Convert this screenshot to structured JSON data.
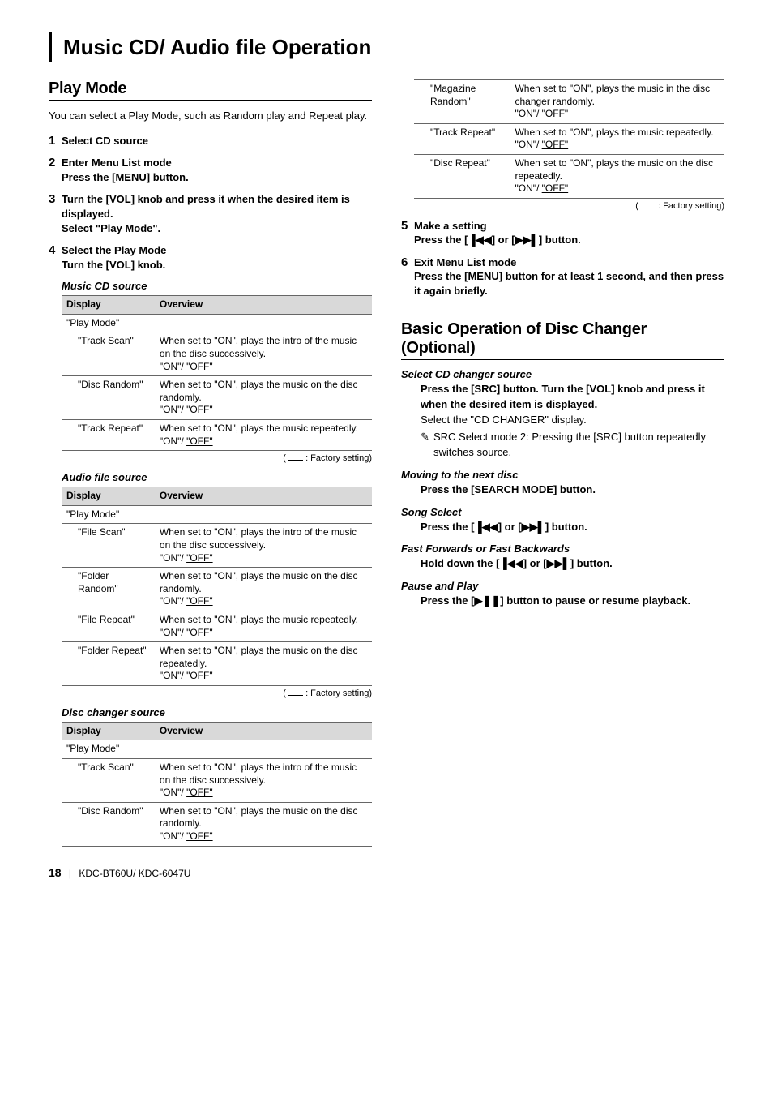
{
  "page_title": "Music CD/ Audio file Operation",
  "left": {
    "play_mode_heading": "Play Mode",
    "play_mode_intro": "You can select a Play Mode, such as Random play and Repeat play.",
    "steps": [
      {
        "num": "1",
        "title": "Select CD source",
        "subs": []
      },
      {
        "num": "2",
        "title": "Enter Menu List mode",
        "subs": [
          "Press the [MENU] button."
        ]
      },
      {
        "num": "3",
        "title": "Turn the [VOL] knob and press it when the desired item is displayed.",
        "subs": [
          "Select \"Play Mode\"."
        ]
      },
      {
        "num": "4",
        "title": "Select the Play Mode",
        "subs": [
          "Turn the [VOL] knob."
        ]
      }
    ],
    "music_cd_label": "Music CD source",
    "audio_file_label": "Audio file source",
    "disc_changer_label": "Disc changer source",
    "col_display": "Display",
    "col_overview": "Overview",
    "play_mode_row": "\"Play Mode\"",
    "factory_label": " : Factory setting)",
    "music_cd_rows": [
      {
        "d": "\"Track Scan\"",
        "o": "When set to \"ON\", plays the intro of the music on the disc successively.",
        "s": "\"ON\"/ \"OFF\""
      },
      {
        "d": "\"Disc Random\"",
        "o": "When set to \"ON\", plays the music on the disc randomly.",
        "s": "\"ON\"/ \"OFF\""
      },
      {
        "d": "\"Track Repeat\"",
        "o": "When set to \"ON\", plays the music repeatedly.",
        "s": "\"ON\"/ \"OFF\""
      }
    ],
    "audio_file_rows": [
      {
        "d": "\"File Scan\"",
        "o": "When set to \"ON\", plays the intro of the music on the disc successively.",
        "s": "\"ON\"/ \"OFF\""
      },
      {
        "d": "\"Folder Random\"",
        "o": "When set to \"ON\", plays the music on the disc randomly.",
        "s": "\"ON\"/ \"OFF\""
      },
      {
        "d": "\"File Repeat\"",
        "o": "When set to \"ON\", plays the music repeatedly.",
        "s": "\"ON\"/ \"OFF\""
      },
      {
        "d": "\"Folder Repeat\"",
        "o": "When set to \"ON\", plays the music on the disc repeatedly.",
        "s": "\"ON\"/ \"OFF\""
      }
    ],
    "disc_changer_rows": [
      {
        "d": "\"Track Scan\"",
        "o": "When set to \"ON\", plays the intro of the music on the disc successively.",
        "s": "\"ON\"/ \"OFF\""
      },
      {
        "d": "\"Disc Random\"",
        "o": "When set to \"ON\", plays the music on the disc randomly.",
        "s": "\"ON\"/ \"OFF\""
      }
    ]
  },
  "right": {
    "top_rows": [
      {
        "d": "\"Magazine Random\"",
        "o": "When set to \"ON\", plays the music in the disc changer randomly.",
        "s": "\"ON\"/ \"OFF\""
      },
      {
        "d": "\"Track Repeat\"",
        "o": "When set to \"ON\", plays the music repeatedly.",
        "s": "\"ON\"/ \"OFF\""
      },
      {
        "d": "\"Disc Repeat\"",
        "o": "When set to \"ON\", plays the music on the disc repeatedly.",
        "s": "\"ON\"/ \"OFF\""
      }
    ],
    "factory_label": " : Factory setting)",
    "step5_num": "5",
    "step5_title": "Make a setting",
    "step5_sub_pre": "Press the [",
    "step5_sub_mid": "] or [",
    "step5_sub_post": "] button.",
    "step6_num": "6",
    "step6_title": "Exit Menu List mode",
    "step6_sub": "Press the [MENU] button for at least 1 second, and then press it again briefly.",
    "basic_heading": "Basic Operation of Disc Changer (Optional)",
    "sel_cd_label": "Select CD changer source",
    "sel_cd_bold": "Press the [SRC] button. Turn the [VOL] knob and press it when the desired item is displayed.",
    "sel_cd_plain": "Select the \"CD CHANGER\" display.",
    "sel_cd_note": "SRC Select mode 2: Pressing the [SRC] button repeatedly switches source.",
    "move_label": "Moving to the next disc",
    "move_bold": "Press the [SEARCH MODE] button.",
    "song_label": "Song Select",
    "song_pre": "Press the [",
    "song_mid": "] or [",
    "song_post": "] button.",
    "fast_label": "Fast Forwards or Fast Backwards",
    "fast_pre": "Hold down the [",
    "fast_mid": "] or [",
    "fast_post": "] button.",
    "pause_label": "Pause and Play",
    "pause_pre": "Press the [",
    "pause_post": "] button to pause or resume playback."
  },
  "footer": {
    "page_num": "18",
    "sep": "|",
    "models": "KDC-BT60U/ KDC-6047U"
  },
  "sym": {
    "prev": "⏮◀◀",
    "next": "▶▶⏭",
    "playpause": "▶❚❚",
    "note_icon": "✎"
  },
  "off_underlined": "\"OFF\""
}
